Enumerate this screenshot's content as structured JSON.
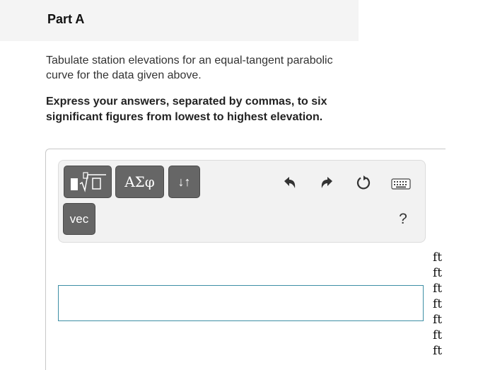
{
  "part": {
    "title": "Part A"
  },
  "question": {
    "text": "Tabulate station elevations for an equal-tangent parabolic curve for the data given above.",
    "instruction": "Express your answers, separated by commas, to six significant figures from lowest to highest elevation."
  },
  "toolbar": {
    "greek_label": "ΑΣφ",
    "arrows_label": "↓↑",
    "vec_label": "vec",
    "help_label": "?",
    "icons": {
      "templates": "template-radical-icon",
      "undo": "undo-icon",
      "redo": "redo-icon",
      "reset": "reset-icon",
      "keyboard": "keyboard-icon"
    }
  },
  "answer": {
    "value": "",
    "units": [
      "ft",
      "ft",
      "ft",
      "ft",
      "ft",
      "ft",
      "ft"
    ]
  },
  "colors": {
    "header_bg": "#f4f4f4",
    "button_bg": "#666666",
    "input_border": "#3d8fa5",
    "toolbar_bg": "#f2f2f2"
  }
}
